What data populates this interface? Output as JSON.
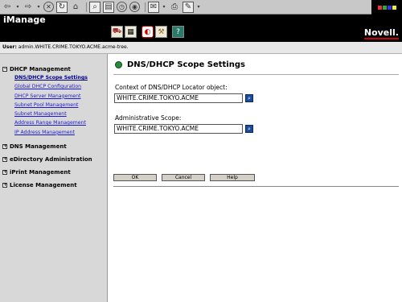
{
  "browser": {
    "toolbar_icons": [
      "back-arrow-icon",
      "forward-arrow-icon",
      "stop-icon",
      "refresh-icon",
      "home-icon",
      "search-icon",
      "favorites-icon",
      "history-icon",
      "mail-icon",
      "print-icon",
      "edit-icon"
    ]
  },
  "app": {
    "title": "iManage",
    "brand": "Novell.",
    "accent_color": "#cc0000",
    "header_icons": [
      "dhcp-icon",
      "directory-icon",
      "active-role-icon",
      "tools-icon",
      "help-icon"
    ]
  },
  "user_bar": {
    "label": "User:",
    "value": "admin.WHITE.CRIME.TOKYO.ACME.acme-tree."
  },
  "sidebar": {
    "dhcp_heading": "DHCP Management",
    "dhcp_items": [
      {
        "label": "DNS/DHCP Scope Settings",
        "current": true
      },
      {
        "label": "Global DHCP Configuration"
      },
      {
        "label": "DHCP Server Management"
      },
      {
        "label": "Subnet Pool Management"
      },
      {
        "label": "Subnet Management"
      },
      {
        "label": "Address Range Management"
      },
      {
        "label": "IP Address Management"
      }
    ],
    "groups": [
      "DNS Management",
      "eDirectory Administration",
      "iPrint Management",
      "License Management"
    ]
  },
  "main": {
    "title": "DNS/DHCP Scope Settings",
    "context_label": "Context of DNS/DHCP Locator object:",
    "context_value": "WHITE.CRIME.TOKYO.ACME",
    "scope_label": "Administrative Scope:",
    "scope_value": "WHITE.CRIME.TOKYO.ACME",
    "ok_label": "OK",
    "cancel_label": "Cancel",
    "help_label": "Help"
  }
}
